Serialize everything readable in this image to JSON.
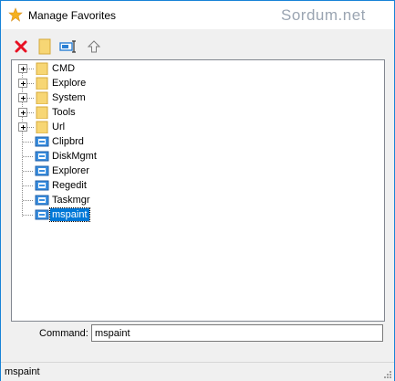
{
  "window": {
    "title": "Manage Favorites",
    "watermark": "Sordum.net"
  },
  "toolbar": {
    "buttons": [
      {
        "icon": "delete-icon",
        "color": "#e81123"
      },
      {
        "icon": "new-folder-icon",
        "color": "#f7d674"
      },
      {
        "icon": "rename-icon",
        "color": "#2a7fd4"
      },
      {
        "icon": "move-up-icon",
        "color": "#808080"
      }
    ]
  },
  "tree": {
    "folders": [
      {
        "label": "CMD"
      },
      {
        "label": "Explore"
      },
      {
        "label": "System"
      },
      {
        "label": "Tools"
      },
      {
        "label": "Url"
      }
    ],
    "items": [
      {
        "label": "Clipbrd"
      },
      {
        "label": "DiskMgmt"
      },
      {
        "label": "Explorer"
      },
      {
        "label": "Regedit"
      },
      {
        "label": "Taskmgr"
      },
      {
        "label": "mspaint",
        "selected": true
      }
    ]
  },
  "command": {
    "label": "Command:",
    "value": "mspaint"
  },
  "status": {
    "text": "mspaint"
  },
  "colors": {
    "accent": "#0078d7",
    "window_border": "#1883d7",
    "folder": "#f7d674"
  }
}
